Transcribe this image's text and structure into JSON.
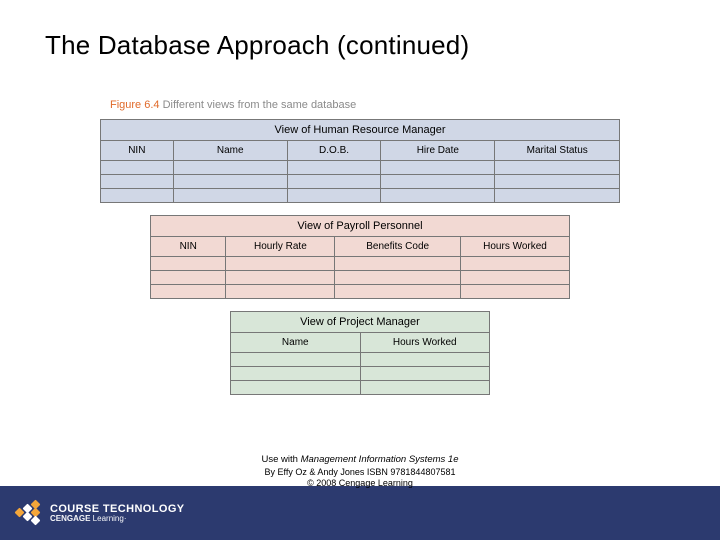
{
  "title": "The Database Approach (continued)",
  "figure": {
    "label": "Figure 6.4",
    "caption": "Different views from the same database"
  },
  "tables": {
    "hr": {
      "title": "View of Human Resource Manager",
      "cols": [
        "NIN",
        "Name",
        "D.O.B.",
        "Hire Date",
        "Marital Status"
      ],
      "rows": 3
    },
    "payroll": {
      "title": "View of Payroll Personnel",
      "cols": [
        "NIN",
        "Hourly Rate",
        "Benefits Code",
        "Hours Worked"
      ],
      "rows": 3
    },
    "pm": {
      "title": "View of Project Manager",
      "cols": [
        "Name",
        "Hours Worked"
      ],
      "rows": 3
    }
  },
  "footer": {
    "use_with_prefix": "Use with ",
    "book_title": "Management Information Systems 1e",
    "byline": "By Effy Oz & Andy Jones ISBN 9781844807581",
    "copyright": "© 2008 Cengage Learning",
    "brand_line1": "COURSE TECHNOLOGY",
    "brand_line2a": "CENGAGE",
    "brand_line2b": " Learning·"
  }
}
